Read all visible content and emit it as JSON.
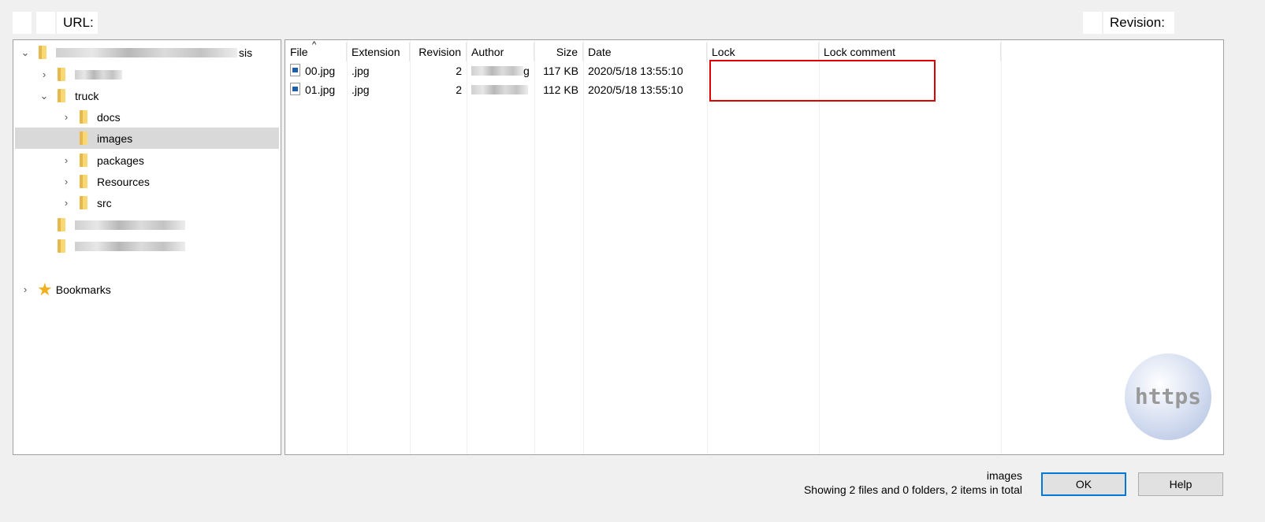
{
  "toolbar": {
    "url_label": "URL:",
    "revision_label": "Revision:"
  },
  "tree": {
    "root_suffix": "sis",
    "items": [
      {
        "label": "truck",
        "expanded": true
      },
      {
        "label": "docs"
      },
      {
        "label": "images",
        "selected": true
      },
      {
        "label": "packages"
      },
      {
        "label": "Resources"
      },
      {
        "label": "src"
      }
    ],
    "bookmarks": "Bookmarks"
  },
  "list": {
    "columns": [
      "File",
      "Extension",
      "Revision",
      "Author",
      "Size",
      "Date",
      "Lock",
      "Lock comment"
    ],
    "rows": [
      {
        "file": "00.jpg",
        "ext": ".jpg",
        "rev": "2",
        "author": "g",
        "size": "117 KB",
        "date": "2020/5/18 13:55:10",
        "lock": "",
        "comment": ""
      },
      {
        "file": "01.jpg",
        "ext": ".jpg",
        "rev": "2",
        "author": "",
        "size": "112 KB",
        "date": "2020/5/18 13:55:10",
        "lock": "",
        "comment": ""
      }
    ]
  },
  "status": {
    "folder": "images",
    "summary": "Showing 2 files and 0 folders, 2 items in total"
  },
  "buttons": {
    "ok": "OK",
    "help": "Help"
  },
  "watermark": "https",
  "colors": {
    "highlight_box": "#e00000",
    "selected_row": "#d9d9d9",
    "ok_border": "#0078d7"
  }
}
